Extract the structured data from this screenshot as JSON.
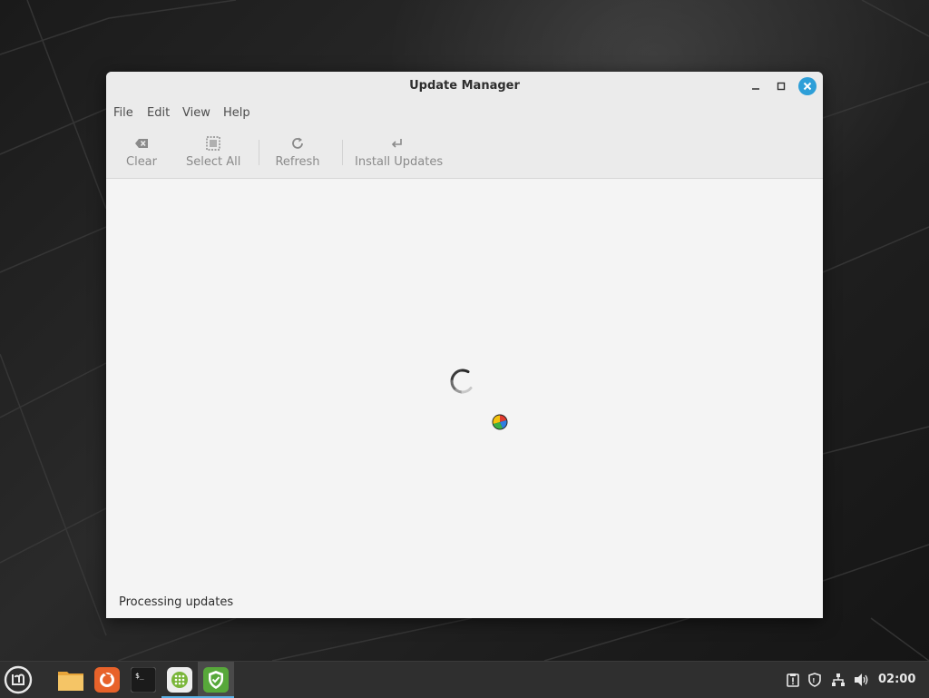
{
  "window": {
    "title": "Update Manager"
  },
  "menu": [
    "File",
    "Edit",
    "View",
    "Help"
  ],
  "toolbar": {
    "clear": "Clear",
    "select_all": "Select All",
    "refresh": "Refresh",
    "install": "Install Updates"
  },
  "status": "Processing updates",
  "taskbar": {
    "clock": "02:00",
    "apps": [
      "mint-menu-icon",
      "files-icon",
      "firefox-icon",
      "terminal-icon",
      "software-manager-icon",
      "update-manager-icon"
    ]
  },
  "colors": {
    "close_button": "#2e9fd8",
    "active_indicator": "#5ab0e4",
    "taskbar": "#2f2f2f"
  }
}
